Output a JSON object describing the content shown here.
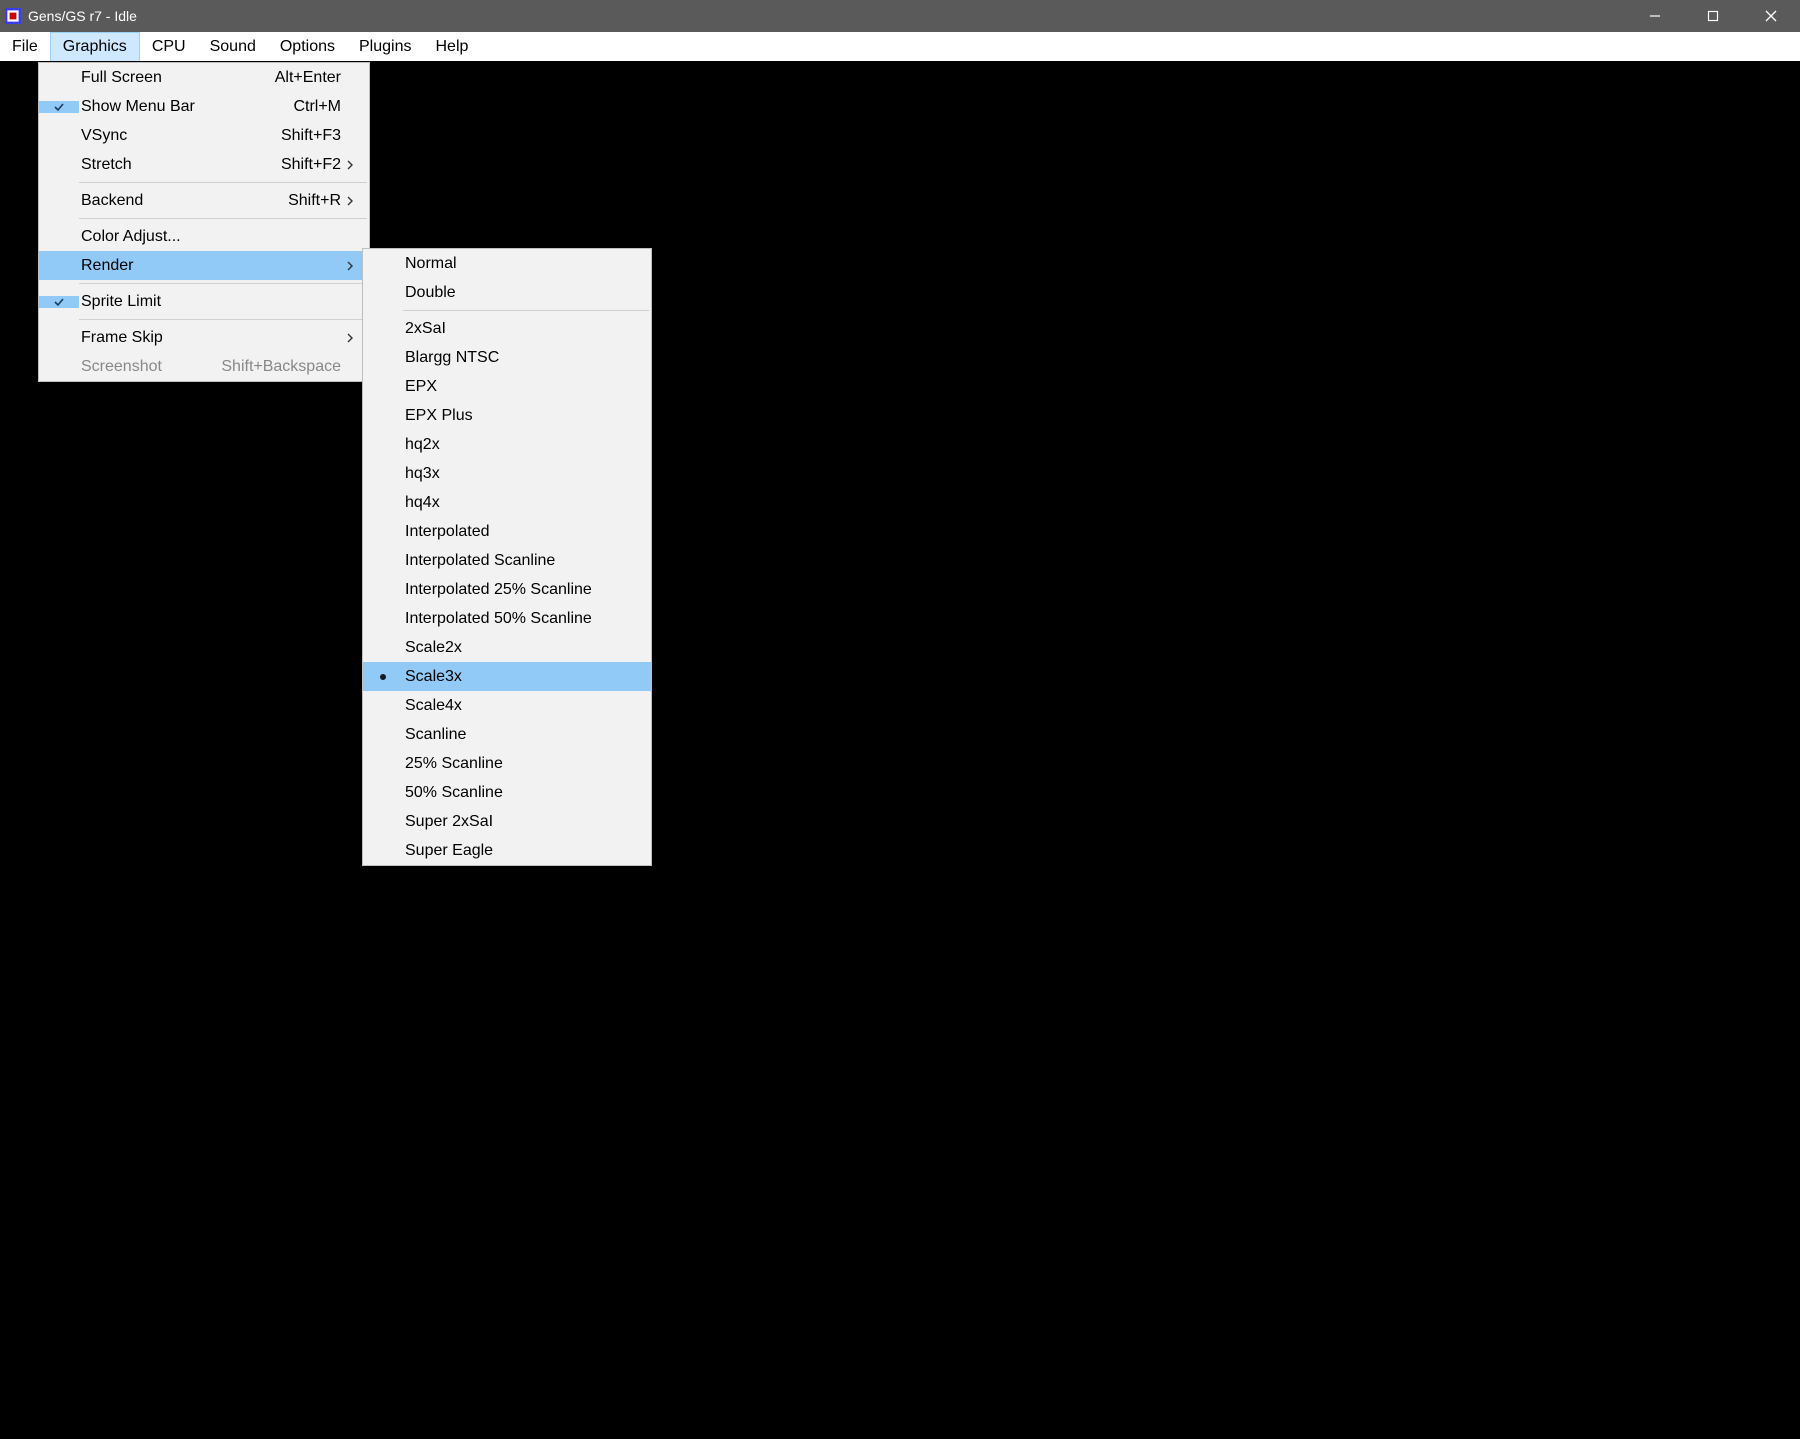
{
  "window": {
    "title": "Gens/GS r7 - Idle"
  },
  "menubar": {
    "items": [
      {
        "label": "File"
      },
      {
        "label": "Graphics"
      },
      {
        "label": "CPU"
      },
      {
        "label": "Sound"
      },
      {
        "label": "Options"
      },
      {
        "label": "Plugins"
      },
      {
        "label": "Help"
      }
    ],
    "active_index": 1
  },
  "graphics_menu": {
    "groups": [
      [
        {
          "label": "Full Screen",
          "shortcut": "Alt+Enter",
          "checked": false,
          "submenu": false
        },
        {
          "label": "Show Menu Bar",
          "shortcut": "Ctrl+M",
          "checked": true,
          "submenu": false
        },
        {
          "label": "VSync",
          "shortcut": "Shift+F3",
          "checked": false,
          "submenu": false
        },
        {
          "label": "Stretch",
          "shortcut": "Shift+F2",
          "checked": false,
          "submenu": true
        }
      ],
      [
        {
          "label": "Backend",
          "shortcut": "Shift+R",
          "checked": false,
          "submenu": true
        }
      ],
      [
        {
          "label": "Color Adjust...",
          "shortcut": "",
          "checked": false,
          "submenu": false
        },
        {
          "label": "Render",
          "shortcut": "",
          "checked": false,
          "submenu": true,
          "highlight": true
        }
      ],
      [
        {
          "label": "Sprite Limit",
          "shortcut": "",
          "checked": true,
          "submenu": false
        }
      ],
      [
        {
          "label": "Frame Skip",
          "shortcut": "",
          "checked": false,
          "submenu": true
        },
        {
          "label": "Screenshot",
          "shortcut": "Shift+Backspace",
          "checked": false,
          "submenu": false,
          "disabled": true
        }
      ]
    ]
  },
  "render_menu": {
    "groups": [
      [
        {
          "label": "Normal"
        },
        {
          "label": "Double"
        }
      ],
      [
        {
          "label": "2xSaI"
        },
        {
          "label": "Blargg NTSC"
        },
        {
          "label": "EPX"
        },
        {
          "label": "EPX Plus"
        },
        {
          "label": "hq2x"
        },
        {
          "label": "hq3x"
        },
        {
          "label": "hq4x"
        },
        {
          "label": "Interpolated"
        },
        {
          "label": "Interpolated Scanline"
        },
        {
          "label": "Interpolated 25% Scanline"
        },
        {
          "label": "Interpolated 50% Scanline"
        },
        {
          "label": "Scale2x"
        },
        {
          "label": "Scale3x",
          "selected": true,
          "highlight": true
        },
        {
          "label": "Scale4x"
        },
        {
          "label": "Scanline"
        },
        {
          "label": "25% Scanline"
        },
        {
          "label": "50% Scanline"
        },
        {
          "label": "Super 2xSaI"
        },
        {
          "label": "Super Eagle"
        }
      ]
    ]
  }
}
